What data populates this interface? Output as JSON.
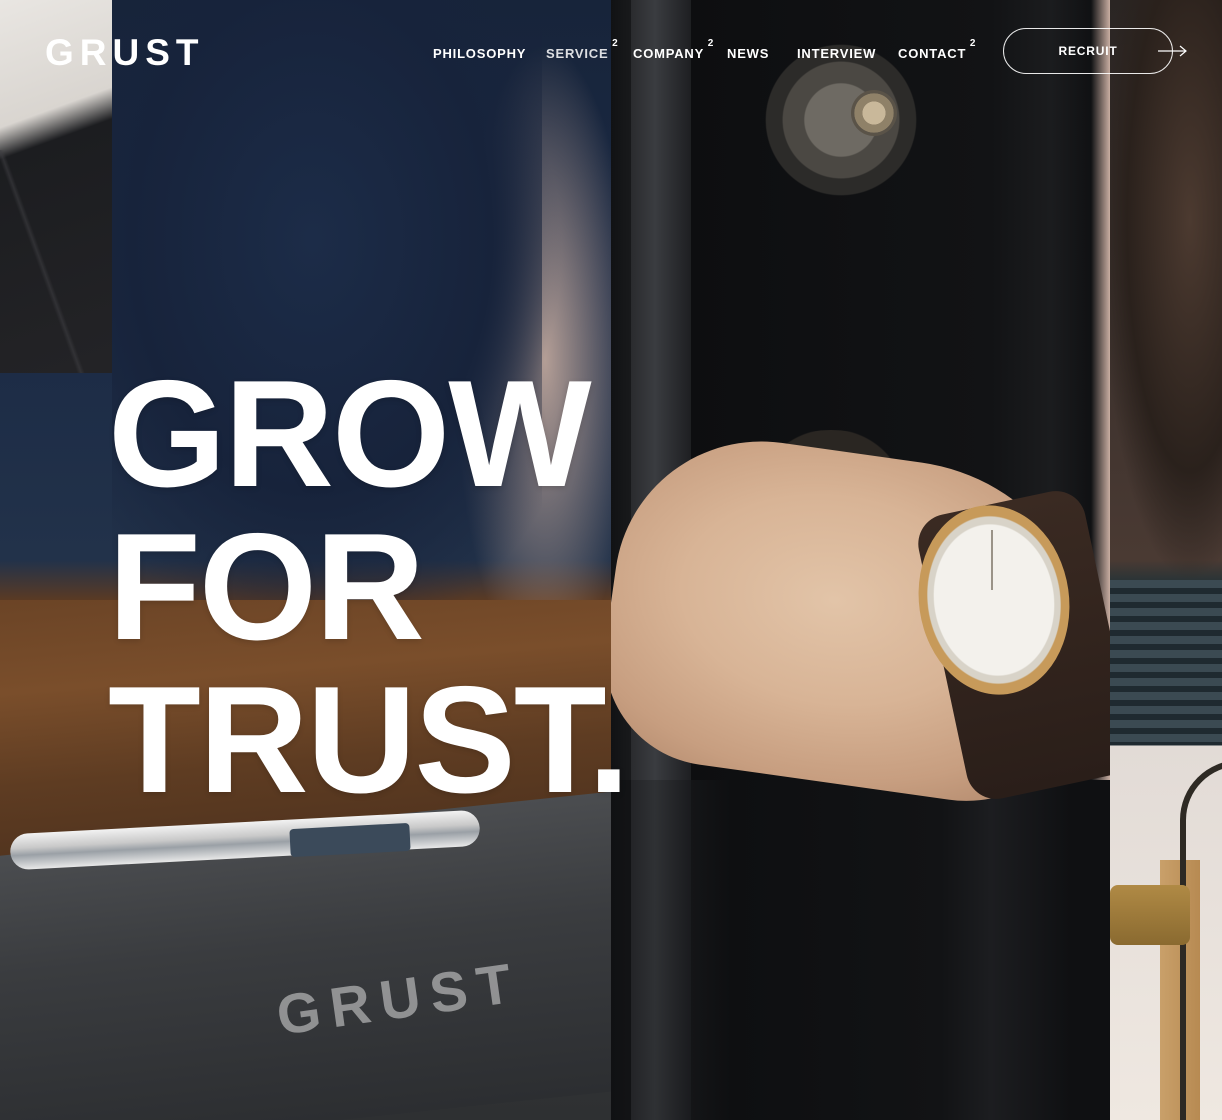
{
  "brand": {
    "logo": "GRUST",
    "folder_emboss": "GRUST"
  },
  "nav": {
    "items": [
      {
        "label": "PHILOSOPHY",
        "badge": ""
      },
      {
        "label": "SERVICE",
        "badge": "2"
      },
      {
        "label": "COMPANY",
        "badge": "2"
      },
      {
        "label": "NEWS",
        "badge": ""
      },
      {
        "label": "INTERVIEW",
        "badge": ""
      },
      {
        "label": "CONTACT",
        "badge": "2"
      }
    ],
    "cta": {
      "label": "RECRUIT",
      "icon": "arrow-right-icon"
    }
  },
  "hero": {
    "lines": [
      "GROW",
      "FOR",
      "TRUST."
    ]
  },
  "colors": {
    "text": "#ffffff",
    "background": "#141414"
  }
}
